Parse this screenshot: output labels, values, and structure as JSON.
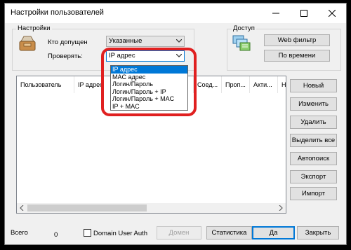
{
  "window": {
    "title": "Настройки пользователей"
  },
  "settings": {
    "group_label": "Настройки",
    "who_label": "Кто допущен",
    "who_value": "Указанные",
    "check_label": "Проверять:",
    "check_value": "IP адрес"
  },
  "access": {
    "group_label": "Доступ",
    "web_filter_button": "Web фильтр",
    "by_time_button": "По времени"
  },
  "table": {
    "columns": [
      "Пользователь",
      "IP адрес",
      "Соед...",
      "Проп...",
      "Акти...",
      "Н"
    ]
  },
  "check_options": {
    "selected_index": 0,
    "items": [
      "IP адрес",
      "MAC адрес",
      "Логин/Пароль",
      "Логин/Пароль + IP",
      "Логин/Пароль + MAC",
      "IP + MAC"
    ]
  },
  "side_buttons": {
    "new": "Новый",
    "edit": "Изменить",
    "delete": "Удалить",
    "select_all": "Выделить все",
    "autosearch": "Автопоиск",
    "export": "Экспорт",
    "import": "Импорт"
  },
  "footer": {
    "total_label": "Всего",
    "total_value": "0",
    "domain_auth_label": "Domain User Auth",
    "domain_button": "Домен",
    "stats_button": "Статистика",
    "ok_button": "Да",
    "close_button": "Закрыть"
  },
  "colors": {
    "selection": "#0078d7",
    "annotation": "#e02020"
  }
}
